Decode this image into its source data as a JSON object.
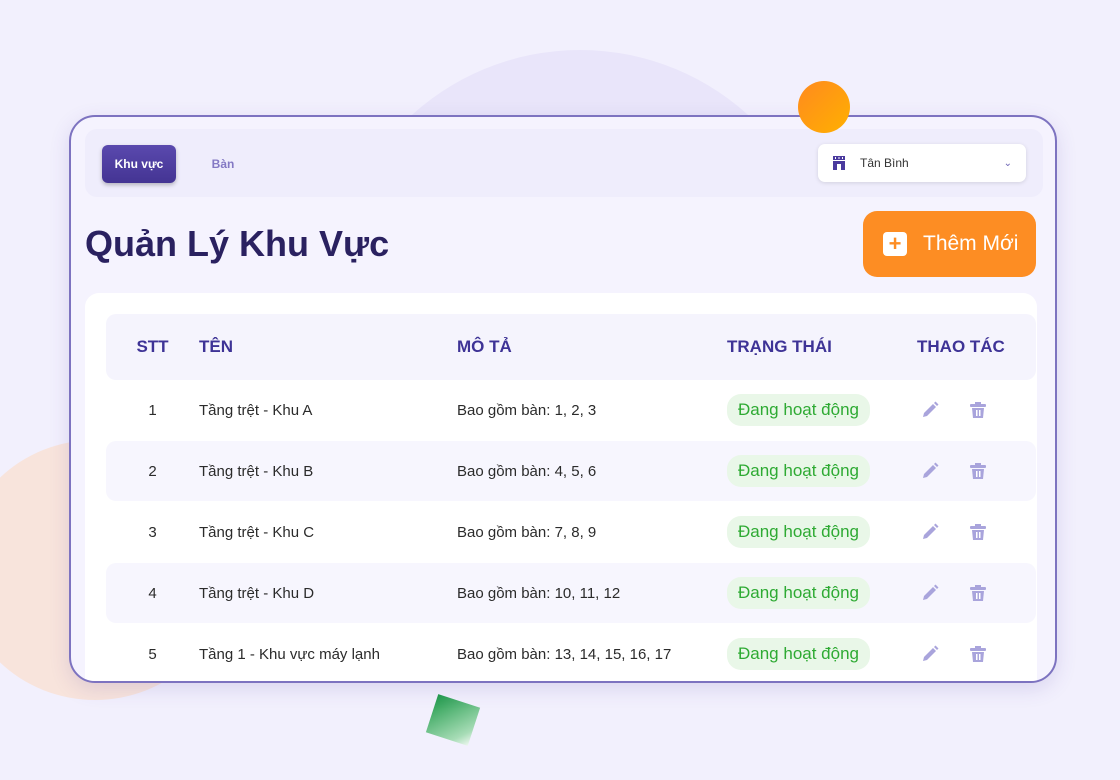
{
  "tabs": [
    {
      "label": "Khu vực",
      "active": true
    },
    {
      "label": "Bàn",
      "active": false
    }
  ],
  "branch_select": {
    "value": "Tân Bình",
    "icon": "store-icon"
  },
  "page_title": "Quản Lý Khu Vực",
  "add_button": {
    "label": "Thêm Mới",
    "icon": "plus-square-icon"
  },
  "table": {
    "headers": [
      "STT",
      "TÊN",
      "MÔ TẢ",
      "TRẠNG THÁI",
      "THAO TÁC"
    ],
    "rows": [
      {
        "stt": "1",
        "name": "Tầng trệt - Khu A",
        "desc": "Bao gồm bàn: 1, 2, 3",
        "status": "Đang hoạt động"
      },
      {
        "stt": "2",
        "name": "Tầng trệt - Khu B",
        "desc": "Bao gồm bàn: 4, 5, 6",
        "status": "Đang hoạt động"
      },
      {
        "stt": "3",
        "name": "Tầng trệt - Khu C",
        "desc": "Bao gồm bàn: 7, 8, 9",
        "status": "Đang hoạt động"
      },
      {
        "stt": "4",
        "name": "Tầng trệt - Khu D",
        "desc": "Bao gồm bàn: 10, 11, 12",
        "status": "Đang hoạt động"
      },
      {
        "stt": "5",
        "name": "Tầng 1 - Khu vực máy lạnh",
        "desc": "Bao gồm bàn: 13, 14, 15, 16, 17",
        "status": "Đang hoạt động"
      }
    ]
  },
  "colors": {
    "primary": "#4a3a9e",
    "accent": "#fd8d23",
    "status_green": "#2eaa33",
    "icon": "#a9a4dc"
  }
}
